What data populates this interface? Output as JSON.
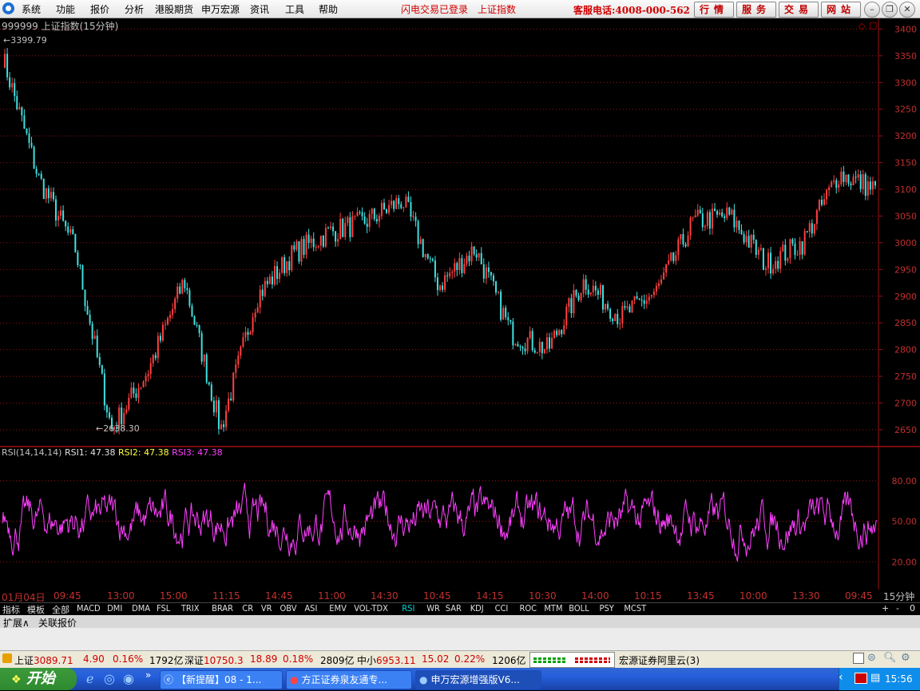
{
  "menu": {
    "items": [
      "系统",
      "功能",
      "报价",
      "分析",
      "港股期货",
      "申万宏源",
      "资讯",
      "工具",
      "帮助"
    ],
    "notice_login": "闪电交易已登录",
    "notice_index": "上证指数",
    "hotline": "客服电话:4008-000-562",
    "right_buttons": [
      "行情",
      "服务",
      "交易",
      "网站"
    ]
  },
  "chart": {
    "title": "999999 上证指数(15分钟)",
    "high_label": "3399.79",
    "low_label": "2638.30",
    "y_ticks": [
      "3400",
      "3350",
      "3300",
      "3250",
      "3200",
      "3150",
      "3100",
      "3050",
      "3000",
      "2950",
      "2900",
      "2850",
      "2800",
      "2750",
      "2700",
      "2650"
    ],
    "rsi_title": "RSI(14,14,14)",
    "rsi1": "RSI1: 47.38",
    "rsi2": "RSI2: 47.38",
    "rsi3": "RSI3: 47.38",
    "rsi_ticks": [
      "80.00",
      "50.00",
      "20.00"
    ],
    "time_labels": [
      "01月04日",
      "09:45",
      "13:00",
      "15:00",
      "11:15",
      "14:45",
      "11:00",
      "14:30",
      "10:45",
      "14:15",
      "10:30",
      "14:00",
      "10:15",
      "13:45",
      "10:00",
      "13:30",
      "09:45"
    ],
    "period": "15分钟",
    "colors": {
      "up": "#ff4040",
      "down": "#40e0e0",
      "rsi": "#ff40ff",
      "grid": "#a01010"
    }
  },
  "chart_data": [
    {
      "type": "line",
      "title": "999999 上证指数(15分钟)",
      "ylim": [
        2620,
        3420
      ],
      "x": [
        "01月04日",
        "09:45",
        "13:00",
        "15:00",
        "11:15",
        "14:45",
        "11:00",
        "14:30",
        "10:45",
        "14:15",
        "10:30",
        "14:00",
        "10:15",
        "13:45",
        "10:00",
        "13:30",
        "09:45"
      ],
      "values": [
        3350,
        3120,
        2990,
        2650,
        2760,
        2930,
        2650,
        2900,
        2980,
        3020,
        3040,
        3080,
        2920,
        2990,
        2830,
        2800,
        2930,
        2860,
        2910,
        3040,
        3050,
        2960,
        3000,
        3130,
        3100
      ],
      "annotations": [
        "3399.79",
        "2638.30"
      ]
    },
    {
      "type": "line",
      "title": "RSI(14,14,14)",
      "ylim": [
        0,
        100
      ],
      "y_ticks": [
        20,
        50,
        80
      ],
      "series": [
        {
          "name": "RSI1",
          "last": 47.38
        },
        {
          "name": "RSI2",
          "last": 47.38
        },
        {
          "name": "RSI3",
          "last": 47.38
        }
      ]
    }
  ],
  "indicator_tabs": [
    "指标",
    "模板",
    "全部",
    "MACD",
    "DMI",
    "DMA",
    "FSL",
    "TRIX",
    "BRAR",
    "CR",
    "VR",
    "OBV",
    "ASI",
    "EMV",
    "VOL-TDX",
    "RSI",
    "WR",
    "SAR",
    "KDJ",
    "CCI",
    "ROC",
    "MTM",
    "BOLL",
    "PSY",
    "MCST"
  ],
  "active_tab": "RSI",
  "ext_tabs": [
    "扩展∧",
    "关联报价"
  ],
  "zoom_buttons": [
    "+",
    "-",
    "0"
  ],
  "status": {
    "sh_name": "上证",
    "sh_value": "3089.71",
    "sh_change": "4.90",
    "sh_pct": "0.16%",
    "sh_amount": "1792亿",
    "sz_name": "深证",
    "sz_value": "10750.3",
    "sz_change": "18.89",
    "sz_pct": "0.18%",
    "sz_amount": "2809亿",
    "zx_name": "中小",
    "zx_value": "6953.11",
    "zx_change": "15.02",
    "zx_pct": "0.22%",
    "zx_amount": "1206亿",
    "server": "宏源证券阿里云(3)"
  },
  "taskbar": {
    "start": "开始",
    "tasks": [
      "【新提醒】08 - 1...",
      "方正证券泉友通专...",
      "申万宏源增强版V6..."
    ],
    "clock": "15:56"
  }
}
